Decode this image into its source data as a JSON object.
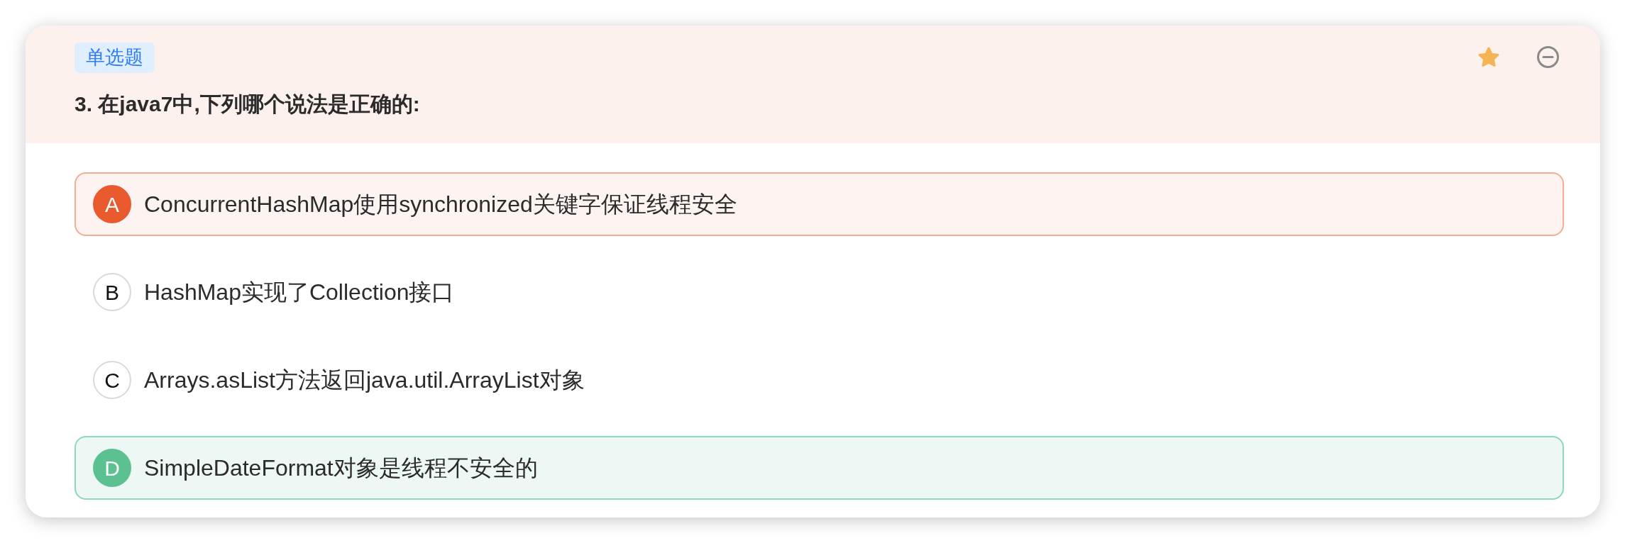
{
  "question": {
    "tag": "单选题",
    "title": "3. 在java7中,下列哪个说法是正确的:",
    "starred": true
  },
  "options": [
    {
      "letter": "A",
      "text": "ConcurrentHashMap使用synchronized关键字保证线程安全",
      "kind": "wrong"
    },
    {
      "letter": "B",
      "text": "HashMap实现了Collection接口",
      "kind": "plain"
    },
    {
      "letter": "C",
      "text": "Arrays.asList方法返回java.util.ArrayList对象",
      "kind": "plain"
    },
    {
      "letter": "D",
      "text": "SimpleDateFormat对象是线程不安全的",
      "kind": "correct"
    }
  ]
}
